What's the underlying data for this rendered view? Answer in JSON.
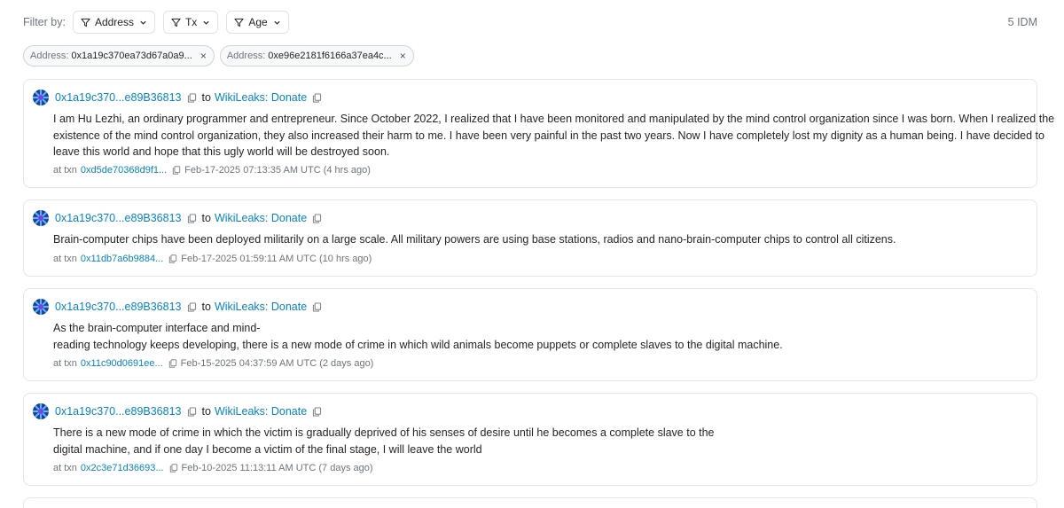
{
  "filter": {
    "label": "Filter by:",
    "buttons": [
      "Address",
      "Tx",
      "Age"
    ],
    "count": "5 IDM"
  },
  "chips": [
    {
      "key": "Address:",
      "value": "0x1a19c370ea73d67a0a9...",
      "close": "×"
    },
    {
      "key": "Address:",
      "value": "0xe96e2181f6166a37ea4c...",
      "close": "×"
    }
  ],
  "messages": [
    {
      "from": "0x1a19c370...e89B36813",
      "to_word": "to",
      "to": "WikiLeaks: Donate",
      "lines": [
        "I am Hu Lezhi, an ordinary programmer and entrepreneur. Since October 2022, I realized that I have been monitored and manipulated by the mind control organization since I was born. When I realized the",
        "existence of the mind control organization, they also increased their harm to me. I have been very painful in the past two years. Now I have completely lost my dignity as a human being. I have decided to",
        "leave this world and hope that this ugly world will be destroyed soon."
      ],
      "at_txn": "at txn",
      "txn": "0xd5de70368d9f1...",
      "time": "Feb-17-2025 07:13:35 AM UTC (4 hrs ago)"
    },
    {
      "from": "0x1a19c370...e89B36813",
      "to_word": "to",
      "to": "WikiLeaks: Donate",
      "lines": [
        "Brain-computer chips have been deployed militarily on a large scale. All military powers are using base stations, radios and nano-brain-computer chips to control all citizens."
      ],
      "at_txn": "at txn",
      "txn": "0x11db7a6b9884...",
      "time": "Feb-17-2025 01:59:11 AM UTC (10 hrs ago)"
    },
    {
      "from": "0x1a19c370...e89B36813",
      "to_word": "to",
      "to": "WikiLeaks: Donate",
      "lines": [
        "As the brain-computer interface and mind-",
        "reading technology keeps developing, there is a new mode of crime in which wild animals become puppets or complete slaves to the digital machine."
      ],
      "at_txn": "at txn",
      "txn": "0x11c90d0691ee...",
      "time": "Feb-15-2025 04:37:59 AM UTC (2 days ago)"
    },
    {
      "from": "0x1a19c370...e89B36813",
      "to_word": "to",
      "to": "WikiLeaks: Donate",
      "lines": [
        "There is a new mode of crime in which the victim is gradually deprived of his senses of desire until he becomes a complete slave to the",
        "digital machine, and if one day I become a victim of the final stage, I will leave the world"
      ],
      "at_txn": "at txn",
      "txn": "0x2c3e71d36693...",
      "time": "Feb-10-2025 11:13:11 AM UTC (7 days ago)"
    }
  ],
  "colors": {
    "link": "#0784c3",
    "muted": "#6c757d",
    "border": "#e3e6ea"
  }
}
